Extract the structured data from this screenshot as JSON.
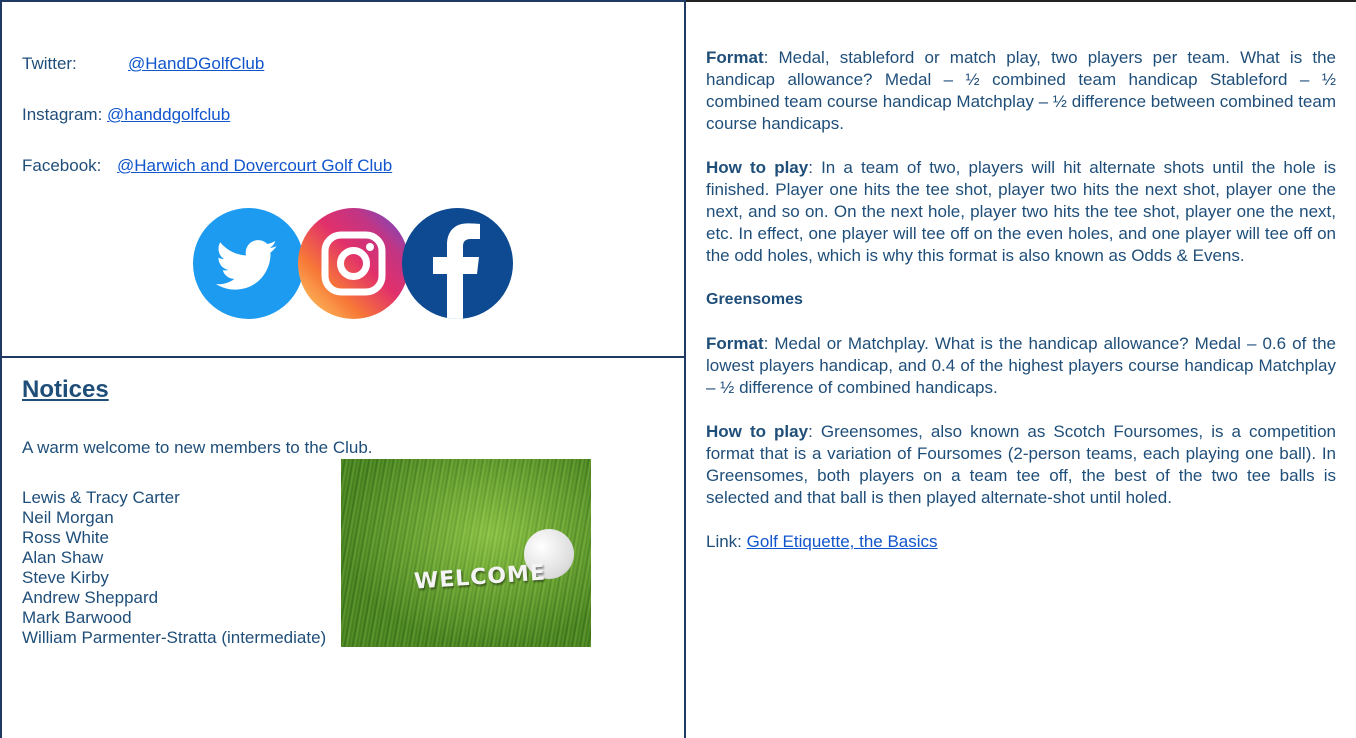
{
  "social": {
    "twitter": {
      "label": "Twitter:",
      "handle": "@HandDGolfClub"
    },
    "instagram": {
      "label": "Instagram:",
      "handle": "@handdgolfclub"
    },
    "facebook": {
      "label": "Facebook:",
      "handle": "@Harwich and Dovercourt Golf Club"
    },
    "icons": [
      "twitter-icon",
      "instagram-icon",
      "facebook-icon"
    ]
  },
  "notices": {
    "title": "Notices",
    "welcome": "A warm welcome to new members to the Club.",
    "members": [
      "Lewis & Tracy Carter",
      "Neil Morgan",
      "Ross White",
      "Alan Shaw",
      "Steve Kirby",
      "Andrew Sheppard",
      "Mark Barwood",
      "William Parmenter-Stratta (intermediate)"
    ],
    "image_text": "WELCOME"
  },
  "right": {
    "foursomes_format_label": "Format",
    "foursomes_format_text": ": Medal, stableford or match play, two players per team. What is the handicap allowance?  Medal – ½ combined team handicap  Stableford – ½ combined team course handicap  Matchplay – ½ difference between combined team course handicaps.",
    "foursomes_play_label": "How to play",
    "foursomes_play_text": ": In a team of two, players will hit alternate shots until the hole is finished. Player one hits the tee shot, player two hits the next shot, player one the next, and so on. On the next hole, player two hits the tee shot, player one the next, etc. In effect, one player will tee off on the even holes, and one player will tee off on the odd holes, which is why this format is also known as Odds & Evens.",
    "greensomes_heading": "Greensomes",
    "greensomes_format_label": "Format",
    "greensomes_format_text": ": Medal or Matchplay. What is the handicap allowance? Medal – 0.6 of the lowest players handicap, and 0.4 of the highest players course handicap  Matchplay – ½ difference of combined handicaps.",
    "greensomes_play_label": "How to play",
    "greensomes_play_text": ": Greensomes, also known as Scotch Foursomes, is a competition format that is a variation of Foursomes (2-person teams, each playing one ball). In Greensomes, both players on a team tee off, the best of the two tee balls is selected and that ball is then played alternate-shot until holed.",
    "link_label": "Link: ",
    "link_text": "Golf Etiquette, the Basics"
  },
  "colors": {
    "border": "#1f3864",
    "text": "#1f4e79",
    "link": "#1155cc"
  }
}
